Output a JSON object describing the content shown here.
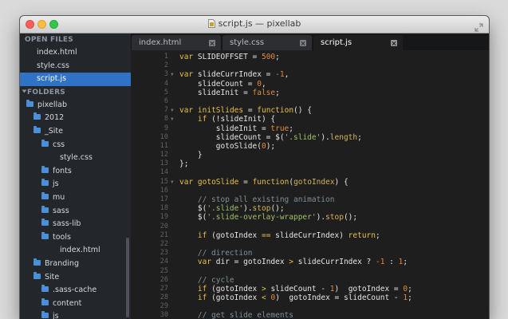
{
  "window": {
    "title": "script.js — pixellab"
  },
  "sidebar": {
    "open_files_header": "OPEN FILES",
    "open_files": [
      {
        "label": "index.html"
      },
      {
        "label": "style.css"
      },
      {
        "label": "script.js",
        "selected": true
      }
    ],
    "folders_header": "FOLDERS",
    "tree": [
      {
        "label": "pixellab",
        "type": "folder",
        "depth": 0
      },
      {
        "label": "2012",
        "type": "folder",
        "depth": 1
      },
      {
        "label": "_Site",
        "type": "folder",
        "depth": 1
      },
      {
        "label": "css",
        "type": "folder",
        "depth": 2
      },
      {
        "label": "style.css",
        "type": "file",
        "depth": 3
      },
      {
        "label": "fonts",
        "type": "folder",
        "depth": 2
      },
      {
        "label": "js",
        "type": "folder",
        "depth": 2
      },
      {
        "label": "mu",
        "type": "folder",
        "depth": 2
      },
      {
        "label": "sass",
        "type": "folder",
        "depth": 2
      },
      {
        "label": "sass-lib",
        "type": "folder",
        "depth": 2
      },
      {
        "label": "tools",
        "type": "folder",
        "depth": 2
      },
      {
        "label": "index.html",
        "type": "file",
        "depth": 3
      },
      {
        "label": "Branding",
        "type": "folder",
        "depth": 1
      },
      {
        "label": "Site",
        "type": "folder",
        "depth": 1
      },
      {
        "label": ".sass-cache",
        "type": "folder",
        "depth": 2
      },
      {
        "label": "content",
        "type": "folder",
        "depth": 2
      },
      {
        "label": "js",
        "type": "folder",
        "depth": 2
      }
    ]
  },
  "tabs": [
    {
      "label": "index.html",
      "active": false
    },
    {
      "label": "style.css",
      "active": false
    },
    {
      "label": "script.js",
      "active": true
    }
  ],
  "code_lines": [
    {
      "n": "1",
      "fold": false,
      "tokens": [
        [
          "kw",
          "var"
        ],
        [
          "op",
          " SLIDEOFFSET = "
        ],
        [
          "num-lit",
          "500"
        ],
        [
          "op",
          ";"
        ]
      ]
    },
    {
      "n": "2",
      "fold": false,
      "tokens": []
    },
    {
      "n": "3",
      "fold": true,
      "tokens": [
        [
          "kw",
          "var"
        ],
        [
          "op",
          " slideCurrIndex = "
        ],
        [
          "num-lit",
          "-1"
        ],
        [
          "op",
          ","
        ]
      ]
    },
    {
      "n": "4",
      "fold": false,
      "tokens": [
        [
          "op",
          "    slideCount = "
        ],
        [
          "num-lit",
          "0"
        ],
        [
          "op",
          ","
        ]
      ]
    },
    {
      "n": "5",
      "fold": false,
      "tokens": [
        [
          "op",
          "    slideInit = "
        ],
        [
          "num-lit",
          "false"
        ],
        [
          "op",
          ";"
        ]
      ]
    },
    {
      "n": "6",
      "fold": false,
      "tokens": []
    },
    {
      "n": "7",
      "fold": true,
      "tokens": [
        [
          "kw",
          "var"
        ],
        [
          "op",
          " "
        ],
        [
          "fn",
          "initSlides"
        ],
        [
          "op",
          " = "
        ],
        [
          "kw",
          "function"
        ],
        [
          "op",
          "() {"
        ]
      ]
    },
    {
      "n": "8",
      "fold": true,
      "tokens": [
        [
          "op",
          "    "
        ],
        [
          "kw",
          "if"
        ],
        [
          "op",
          " (!slideInit) {"
        ]
      ]
    },
    {
      "n": "9",
      "fold": false,
      "tokens": [
        [
          "op",
          "        slideInit = "
        ],
        [
          "num-lit",
          "true"
        ],
        [
          "op",
          ";"
        ]
      ]
    },
    {
      "n": "10",
      "fold": false,
      "tokens": [
        [
          "op",
          "        slideCount = $("
        ],
        [
          "str",
          "'.slide'"
        ],
        [
          "op",
          ")."
        ],
        [
          "prop",
          "length"
        ],
        [
          "op",
          ";"
        ]
      ]
    },
    {
      "n": "11",
      "fold": false,
      "tokens": [
        [
          "op",
          "        gotoSlide("
        ],
        [
          "num-lit",
          "0"
        ],
        [
          "op",
          ");"
        ]
      ]
    },
    {
      "n": "12",
      "fold": false,
      "tokens": [
        [
          "op",
          "    }"
        ]
      ]
    },
    {
      "n": "13",
      "fold": false,
      "tokens": [
        [
          "op",
          "};"
        ]
      ]
    },
    {
      "n": "14",
      "fold": false,
      "tokens": []
    },
    {
      "n": "15",
      "fold": true,
      "tokens": [
        [
          "kw",
          "var"
        ],
        [
          "op",
          " "
        ],
        [
          "fn",
          "gotoSlide"
        ],
        [
          "op",
          " = "
        ],
        [
          "kw",
          "function"
        ],
        [
          "op",
          "("
        ],
        [
          "prop",
          "gotoIndex"
        ],
        [
          "op",
          ") {"
        ]
      ]
    },
    {
      "n": "16",
      "fold": false,
      "tokens": []
    },
    {
      "n": "17",
      "fold": false,
      "tokens": [
        [
          "cm",
          "    // stop all existing animation"
        ]
      ]
    },
    {
      "n": "18",
      "fold": false,
      "tokens": [
        [
          "op",
          "    $("
        ],
        [
          "str",
          "'.slide'"
        ],
        [
          "op",
          ")."
        ],
        [
          "prop",
          "stop"
        ],
        [
          "op",
          "();"
        ]
      ]
    },
    {
      "n": "19",
      "fold": false,
      "tokens": [
        [
          "op",
          "    $("
        ],
        [
          "str",
          "'.slide-overlay-wrapper'"
        ],
        [
          "op",
          ")."
        ],
        [
          "prop",
          "stop"
        ],
        [
          "op",
          "();"
        ]
      ]
    },
    {
      "n": "20",
      "fold": false,
      "tokens": []
    },
    {
      "n": "21",
      "fold": false,
      "tokens": [
        [
          "op",
          "    "
        ],
        [
          "kw",
          "if"
        ],
        [
          "op",
          " (gotoIndex "
        ],
        [
          "kw",
          "=="
        ],
        [
          "op",
          " slideCurrIndex) "
        ],
        [
          "kw",
          "return"
        ],
        [
          "op",
          ";"
        ]
      ]
    },
    {
      "n": "22",
      "fold": false,
      "tokens": []
    },
    {
      "n": "23",
      "fold": false,
      "tokens": [
        [
          "cm",
          "    // direction"
        ]
      ]
    },
    {
      "n": "24",
      "fold": false,
      "tokens": [
        [
          "op",
          "    "
        ],
        [
          "kw",
          "var"
        ],
        [
          "op",
          " dir = gotoIndex "
        ],
        [
          "kw",
          ">"
        ],
        [
          "op",
          " slideCurrIndex ? "
        ],
        [
          "num-lit",
          "-1"
        ],
        [
          "op",
          " : "
        ],
        [
          "num-lit",
          "1"
        ],
        [
          "op",
          ";"
        ]
      ]
    },
    {
      "n": "25",
      "fold": false,
      "tokens": []
    },
    {
      "n": "26",
      "fold": false,
      "tokens": [
        [
          "cm",
          "    // cycle"
        ]
      ]
    },
    {
      "n": "27",
      "fold": false,
      "tokens": [
        [
          "op",
          "    "
        ],
        [
          "kw",
          "if"
        ],
        [
          "op",
          " (gotoIndex "
        ],
        [
          "kw",
          ">"
        ],
        [
          "op",
          " slideCount - "
        ],
        [
          "num-lit",
          "1"
        ],
        [
          "op",
          ")  gotoIndex = "
        ],
        [
          "num-lit",
          "0"
        ],
        [
          "op",
          ";"
        ]
      ]
    },
    {
      "n": "28",
      "fold": false,
      "tokens": [
        [
          "op",
          "    "
        ],
        [
          "kw",
          "if"
        ],
        [
          "op",
          " (gotoIndex "
        ],
        [
          "kw",
          "<"
        ],
        [
          "op",
          " "
        ],
        [
          "num-lit",
          "0"
        ],
        [
          "op",
          ")  gotoIndex = slideCount - "
        ],
        [
          "num-lit",
          "1"
        ],
        [
          "op",
          ";"
        ]
      ]
    },
    {
      "n": "29",
      "fold": false,
      "tokens": []
    },
    {
      "n": "30",
      "fold": false,
      "tokens": [
        [
          "cm",
          "    // get slide elements"
        ]
      ]
    }
  ],
  "colors": {
    "selection": "#2f72c6",
    "keyword": "#e8c04a",
    "number": "#e08a3c",
    "string": "#9fc06a",
    "comment": "#7e8f9a"
  }
}
